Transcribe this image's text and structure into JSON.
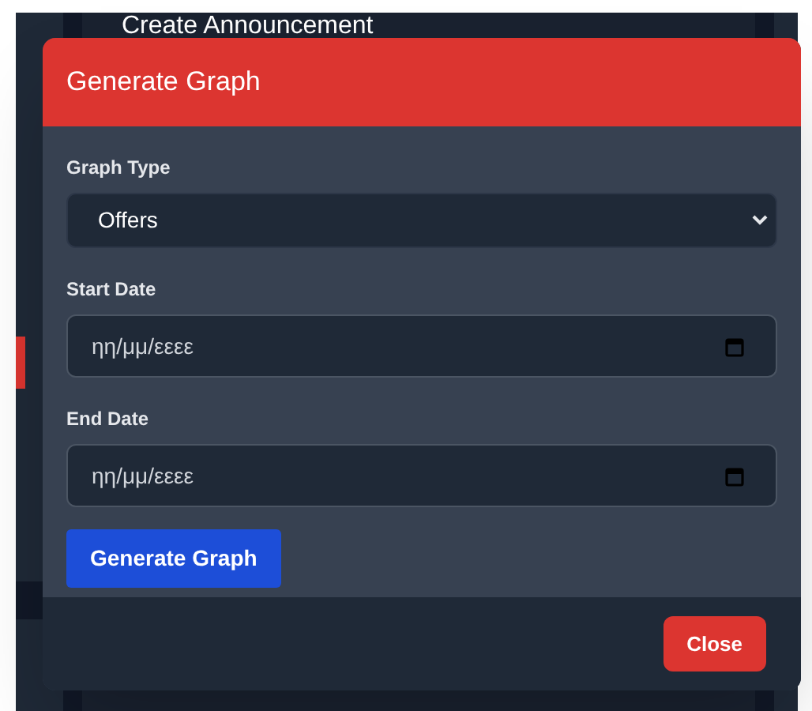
{
  "background": {
    "heading": "Create Announcement"
  },
  "dialog": {
    "title": "Generate Graph",
    "fields": [
      {
        "kind": "select",
        "label": "Graph Type",
        "value": "Offers"
      },
      {
        "kind": "date",
        "label": "Start Date",
        "placeholder": "ηη/μμ/εεεε"
      },
      {
        "kind": "date",
        "label": "End Date",
        "placeholder": "ηη/μμ/εεεε"
      }
    ],
    "submit_button": "Generate Graph",
    "close_button": "Close"
  }
}
